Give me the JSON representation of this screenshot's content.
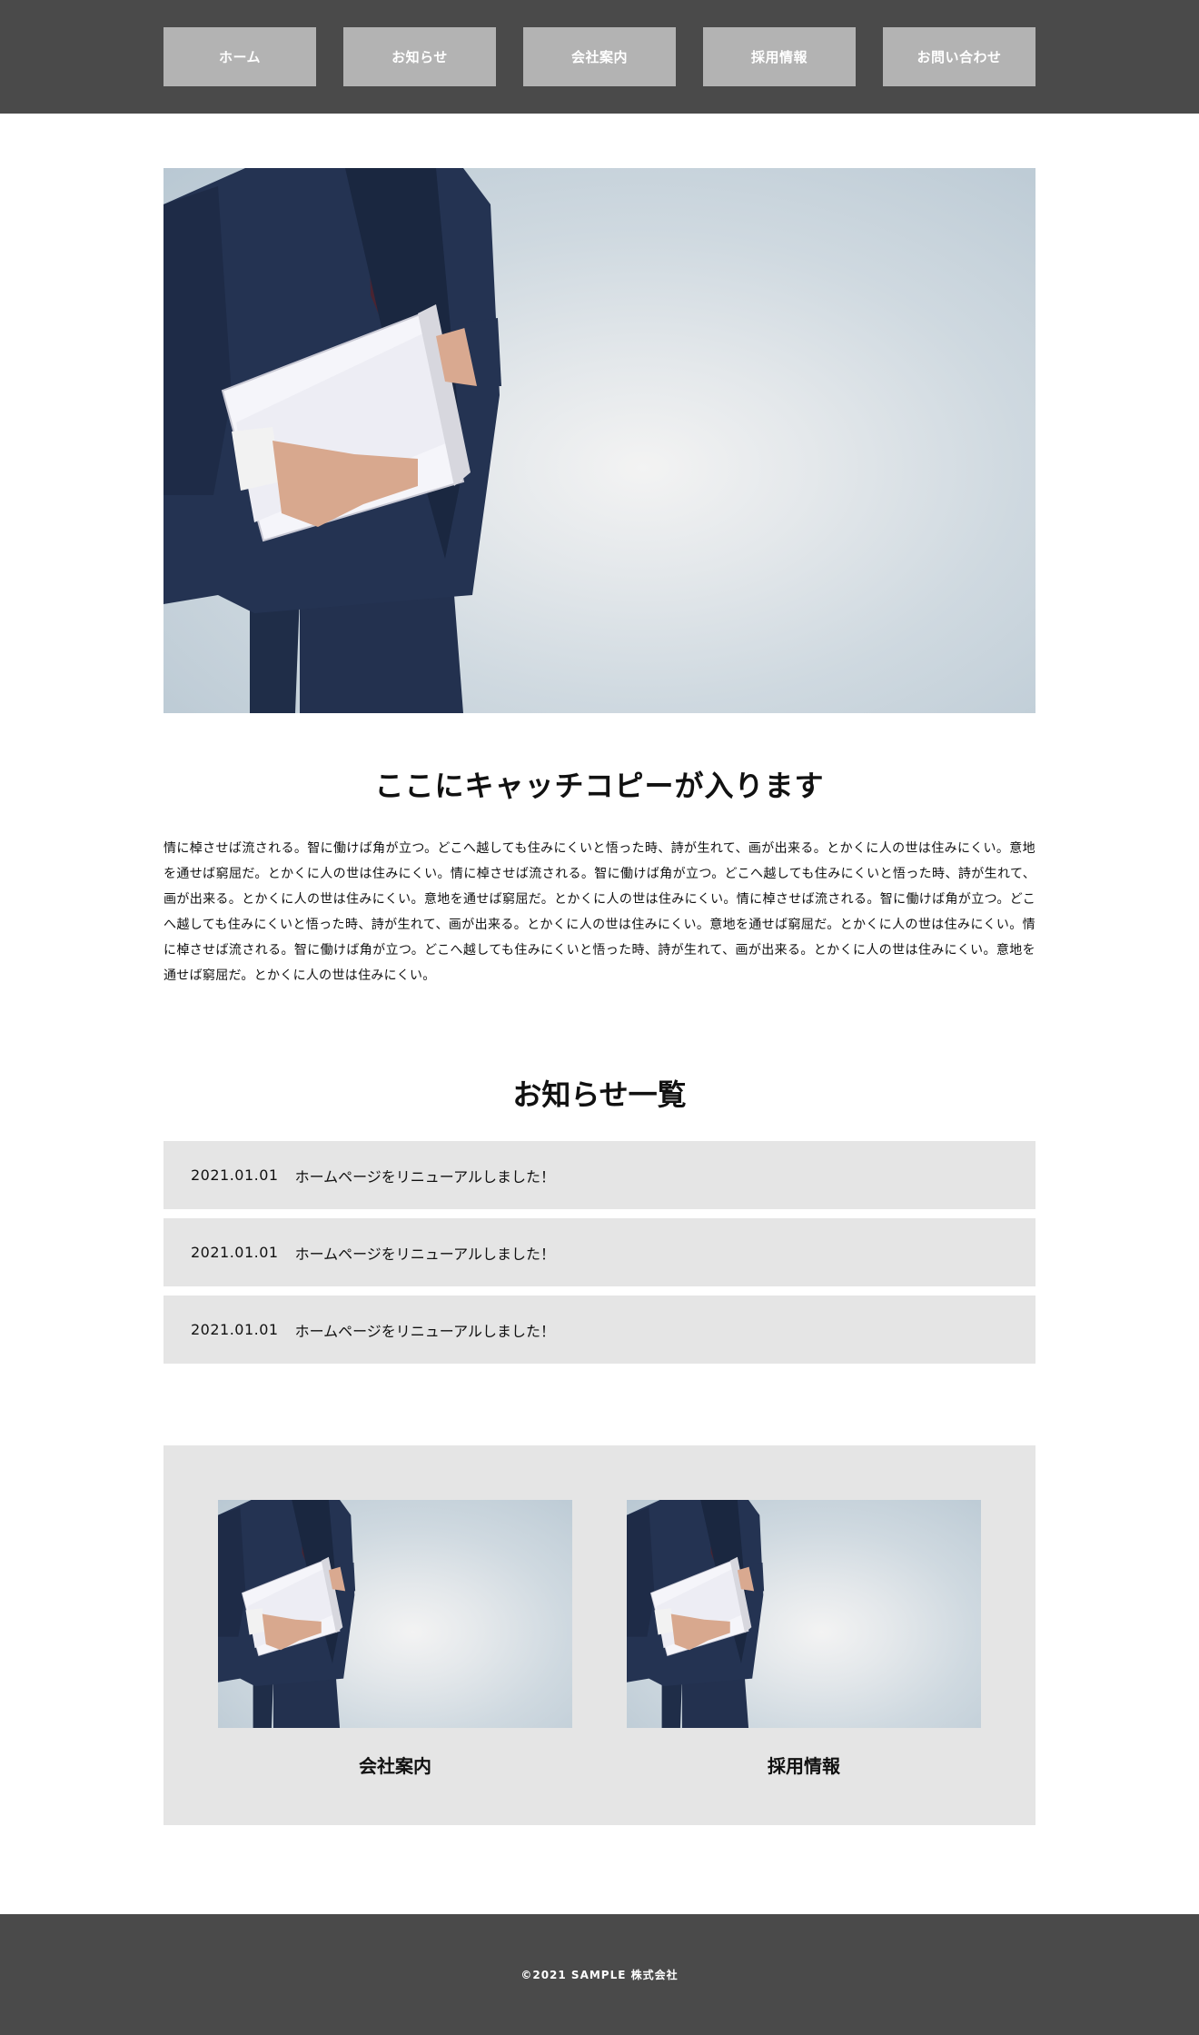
{
  "nav": {
    "items": [
      {
        "label": "ホーム"
      },
      {
        "label": "お知らせ"
      },
      {
        "label": "会社案内"
      },
      {
        "label": "採用情報"
      },
      {
        "label": "お問い合わせ"
      }
    ]
  },
  "catch": {
    "title": "ここにキャッチコピーが入ります",
    "text": "情に棹させば流される。智に働けば角が立つ。どこへ越しても住みにくいと悟った時、詩が生れて、画が出来る。とかくに人の世は住みにくい。意地を通せば窮屈だ。とかくに人の世は住みにくい。情に棹させば流される。智に働けば角が立つ。どこへ越しても住みにくいと悟った時、詩が生れて、画が出来る。とかくに人の世は住みにくい。意地を通せば窮屈だ。とかくに人の世は住みにくい。情に棹させば流される。智に働けば角が立つ。どこへ越しても住みにくいと悟った時、詩が生れて、画が出来る。とかくに人の世は住みにくい。意地を通せば窮屈だ。とかくに人の世は住みにくい。情に棹させば流される。智に働けば角が立つ。どこへ越しても住みにくいと悟った時、詩が生れて、画が出来る。とかくに人の世は住みにくい。意地を通せば窮屈だ。とかくに人の世は住みにくい。"
  },
  "news": {
    "title": "お知らせ一覧",
    "items": [
      {
        "date": "2021.01.01",
        "text": "ホームページをリニューアルしました！"
      },
      {
        "date": "2021.01.01",
        "text": "ホームページをリニューアルしました！"
      },
      {
        "date": "2021.01.01",
        "text": "ホームページをリニューアルしました！"
      }
    ]
  },
  "cards": [
    {
      "label": "会社案内"
    },
    {
      "label": "採用情報"
    }
  ],
  "footer": {
    "copyright": "©2021 SAMPLE 株式会社"
  },
  "colors": {
    "header_bg": "#4a4a4a",
    "nav_button": "#b3b3b3",
    "panel_bg": "#e5e5e5",
    "footer_bg": "#4a4a4a"
  }
}
